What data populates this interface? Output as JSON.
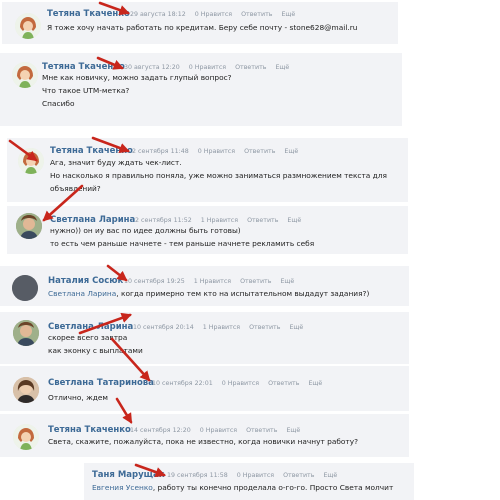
{
  "colors": {
    "name": "#3d6a96",
    "meta": "#8d97a3",
    "card_bg": "#f2f3f6",
    "arrow": "#c8261c"
  },
  "comments": [
    {
      "author": "Тетяна Ткаченко",
      "date": "29 августа 18:12",
      "likes": "0 Нравится",
      "reply": "Ответить",
      "more": "Ещё",
      "lines": [
        "Я тоже хочу начать работать по кредитам. Беру себе почту - stone628@mail.ru"
      ],
      "avatar": "cartoon-girl-icon"
    },
    {
      "author": "Тетяна Ткаченко",
      "date": "30 августа 12:20",
      "likes": "0 Нравится",
      "reply": "Ответить",
      "more": "Ещё",
      "lines": [
        "Мне как новичку, можно задать глупый вопрос?",
        "Что такое UTM-метка?",
        "Спасибо"
      ],
      "avatar": "cartoon-girl-icon"
    },
    {
      "author": "Тетяна Ткаченко",
      "date": "2 сентября 11:48",
      "likes": "0 Нравится",
      "reply": "Ответить",
      "more": "Ещё",
      "lines": [
        "Ага, значит буду ждать чек-лист.",
        "Но насколько я правильно поняла, уже можно заниматься размножением текста для",
        "объявлений?"
      ],
      "avatar": "cartoon-girl-icon"
    },
    {
      "author": "Светлана Ларина",
      "date": "2 сентября 11:52",
      "likes": "1 Нравится",
      "reply": "Ответить",
      "more": "Ещё",
      "lines": [
        "нужно)) он иу вас по идее должны быть готовы)",
        "то есть чем раньше начнете - тем раньше начнете рекламить себя"
      ],
      "avatar": "photo-avatar"
    },
    {
      "author": "Наталия Сосюк",
      "date": "10 сентября 19:25",
      "likes": "1 Нравится",
      "reply": "Ответить",
      "more": "Ещё",
      "mention": "Светлана Ларина",
      "rest": ", когда примерно тем кто на испытательном выдадут задания?)",
      "avatar": "gray-avatar"
    },
    {
      "author": "Светлана Ларина",
      "date": "10 сентября 20:14",
      "likes": "1 Нравится",
      "reply": "Ответить",
      "more": "Ещё",
      "lines": [
        "скорее всего завтра",
        "как эконку с выплатами"
      ],
      "avatar": "photo-avatar"
    },
    {
      "author": "Светлана Татаринова",
      "date": "10 сентября 22:01",
      "likes": "0 Нравится",
      "reply": "Ответить",
      "more": "Ещё",
      "lines": [
        "Отлично, ждем"
      ],
      "avatar": "photo-avatar-2"
    },
    {
      "author": "Тетяна Ткаченко",
      "date": "14 сентября 12:20",
      "likes": "0 Нравится",
      "reply": "Ответить",
      "more": "Ещё",
      "lines": [
        "Света, скажите, пожалуйста, пока не известно, когда новички начнут работу?"
      ],
      "avatar": "cartoon-girl-icon"
    },
    {
      "author": "Таня Марущак",
      "date": "19 сентября 11:58",
      "likes": "0 Нравится",
      "reply": "Ответить",
      "more": "Ещё",
      "mention": "Евгения Усенко",
      "rest": ", работу ты конечно проделала о-го-го. Просто Света молчит",
      "avatar": "none"
    }
  ]
}
